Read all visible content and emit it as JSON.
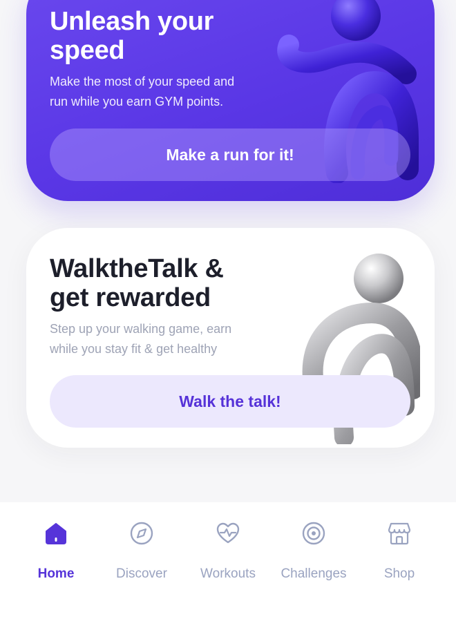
{
  "cards": {
    "run": {
      "title": "Unleash your speed",
      "title_line1": "Unleash your",
      "title_line2": "speed",
      "description_line1": "Make the most of your speed and",
      "description_line2": "run while you earn GYM points.",
      "button_label": "Make a run for it!",
      "accent": "#5a37e6"
    },
    "walk": {
      "title_line1": "WalktheTalk &",
      "title_line2": "get rewarded",
      "description_line1": "Step up your walking game, earn",
      "description_line2": "while you stay fit & get healthy",
      "button_label": "Walk the talk!",
      "accent": "#5632d8"
    }
  },
  "tabbar": {
    "active": "Home",
    "items": [
      {
        "label": "Home",
        "icon": "home-icon"
      },
      {
        "label": "Discover",
        "icon": "compass-icon"
      },
      {
        "label": "Workouts",
        "icon": "heart-pulse-icon"
      },
      {
        "label": "Challenges",
        "icon": "target-icon"
      },
      {
        "label": "Shop",
        "icon": "store-icon"
      }
    ]
  }
}
